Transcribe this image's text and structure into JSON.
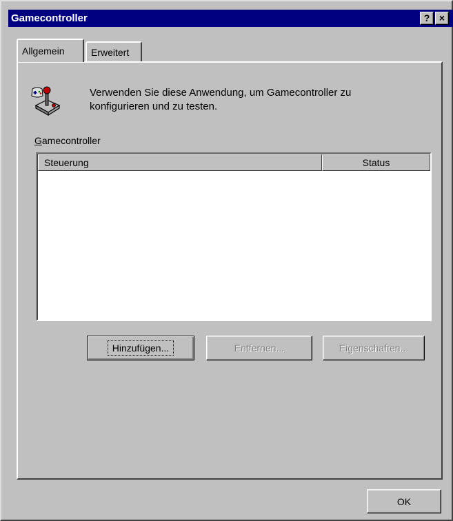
{
  "window": {
    "title": "Gamecontroller",
    "help_button": "?",
    "close_button": "×"
  },
  "tabs": [
    {
      "label": "Allgemein",
      "active": true
    },
    {
      "label": "Erweitert",
      "active": false
    }
  ],
  "general": {
    "icon": "joystick-icon",
    "description": "Verwenden Sie diese Anwendung, um Gamecontroller zu konfigurieren und zu testen.",
    "group_label_mnemonic": "G",
    "group_label_rest": "amecontroller",
    "list": {
      "columns": [
        "Steuerung",
        "Status"
      ],
      "rows": []
    },
    "buttons": {
      "add": "Hinzufügen...",
      "remove": "Entfernen...",
      "properties": "Eigenschaften..."
    }
  },
  "footer": {
    "ok": "OK"
  },
  "colors": {
    "titlebar": "#000080",
    "face": "#c0c0c0",
    "disabled_text": "#808080"
  }
}
